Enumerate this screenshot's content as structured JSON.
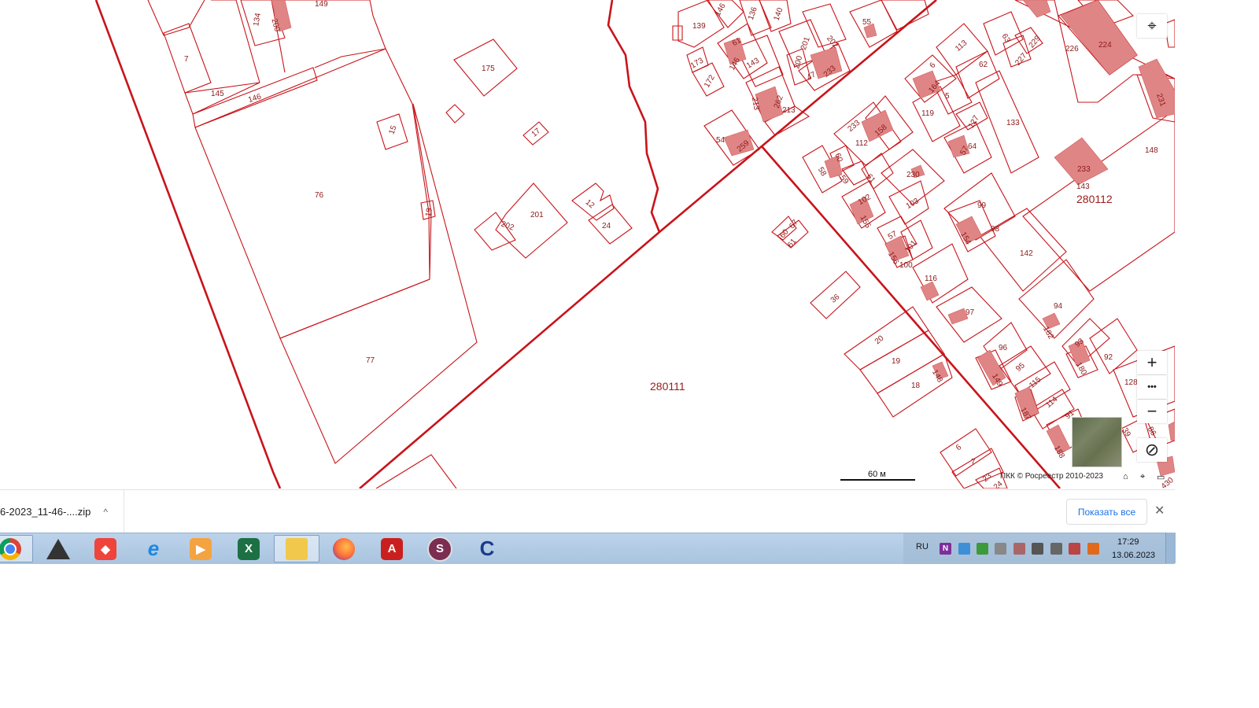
{
  "map": {
    "quarter_labels": [
      "280111",
      "280112"
    ],
    "plot_labels": {
      "p149": "149",
      "p134": "134",
      "p200a": "200",
      "p7a": "7",
      "p145": "145",
      "p146a": "146",
      "p175": "175",
      "p15": "15",
      "p17": "17",
      "p76": "76",
      "p19": "19",
      "p201a": "201",
      "p202a": "202",
      "p12": "12",
      "p24": "24",
      "p77": "77",
      "p146b": "146",
      "p136": "136",
      "p140": "140",
      "p139": "139",
      "p61a": "61",
      "p146c": "146",
      "p143a": "143",
      "p173": "173",
      "p172": "172",
      "p201b": "201",
      "p202b": "202",
      "p200b": "200",
      "p47": "47",
      "p233a": "233",
      "p55a": "55",
      "p213": "213",
      "p262": "262",
      "p213b": "213",
      "p54": "54",
      "p259": "259",
      "p113": "113",
      "p63": "63",
      "p229": "229",
      "p226": "226",
      "p224": "224",
      "p6a": "6",
      "p164": "164",
      "p62": "62",
      "p227": "227",
      "p5": "5",
      "p119": "119",
      "p127": "127",
      "p133": "133",
      "p231": "231",
      "p233b": "233",
      "p112": "112",
      "p158": "158",
      "p57a": "57",
      "p64": "64",
      "p148": "148",
      "p233c": "233",
      "p143b": "143",
      "p58": "58",
      "p60a": "60",
      "p59": "59",
      "p61b": "61",
      "p230": "230",
      "p102": "102",
      "p103": "103",
      "p155": "155",
      "p99": "99",
      "p98": "98",
      "p154": "154",
      "p67": "67",
      "p60b": "60",
      "p61c": "61",
      "p57b": "57",
      "p101": "101",
      "p156": "156",
      "p100": "100",
      "p142": "142",
      "p116": "116",
      "p36": "36",
      "p94": "94",
      "p97": "97",
      "p182": "182",
      "p20": "20",
      "p93": "93",
      "p96": "96",
      "p92": "92",
      "p19b": "19",
      "p180": "180",
      "p95": "95",
      "p149b": "149",
      "p148b": "148",
      "p115": "115",
      "p128": "128",
      "p18": "18",
      "p114": "114",
      "p187": "187",
      "p91": "91",
      "p86": "86",
      "p39": "39",
      "p188": "188",
      "p6b": "6",
      "p7b": "7",
      "p23": "23",
      "p24b": "24",
      "p430": "430"
    },
    "scale_label": "60 м",
    "copyright": "ПКК © Росреестр 2010-2023",
    "controls": {
      "locate_icon": "⌖",
      "zoom_in": "+",
      "more": "•••",
      "zoom_out": "−",
      "compass": "⊘",
      "home_icon": "⌂",
      "pin_icon": "⌖",
      "screen_icon": "▭"
    }
  },
  "downloads": {
    "file_name": "6-2023_11-46-....zip",
    "chevron": "^",
    "show_all_label": "Показать все",
    "close_label": "✕"
  },
  "taskbar": {
    "apps": [
      "chrome",
      "anydesk-pyramid",
      "anydesk",
      "internet-explorer",
      "media-player",
      "excel",
      "file-explorer",
      "firefox",
      "acrobat-reader",
      "s-app",
      "c-app"
    ],
    "language": "RU",
    "time": "17:29",
    "date": "13.06.2023"
  },
  "colors": {
    "boundary": "#c8141a",
    "building": "#e08585",
    "label": "#8b1a1a",
    "taskbar": "#bcd3ea",
    "link": "#1a73e8"
  }
}
